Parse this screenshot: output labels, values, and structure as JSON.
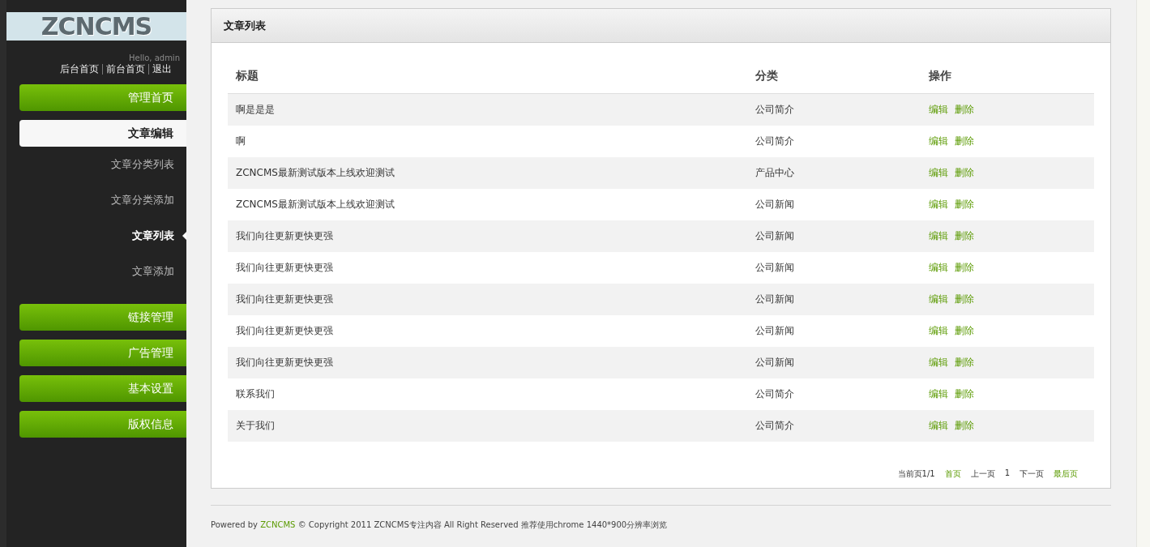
{
  "sidebar": {
    "logo": "ZCNCMS",
    "greeting": "Hello, admin",
    "links": [
      "后台首页",
      "前台首页",
      "退出"
    ],
    "menu": [
      {
        "kind": "button",
        "label": "管理首页"
      },
      {
        "kind": "group",
        "label": "文章编辑",
        "expanded": true,
        "children": [
          {
            "label": "文章分类列表",
            "selected": false
          },
          {
            "label": "文章分类添加",
            "selected": false
          },
          {
            "label": "文章列表",
            "selected": true
          },
          {
            "label": "文章添加",
            "selected": false
          }
        ]
      },
      {
        "kind": "button",
        "label": "链接管理"
      },
      {
        "kind": "button",
        "label": "广告管理"
      },
      {
        "kind": "button",
        "label": "基本设置"
      },
      {
        "kind": "button",
        "label": "版权信息"
      }
    ]
  },
  "panel": {
    "title": "文章列表",
    "table": {
      "columns": [
        "标题",
        "分类",
        "操作"
      ],
      "rows": [
        {
          "title": "啊是是是",
          "category": "公司简介",
          "actions": [
            "编辑",
            "删除"
          ]
        },
        {
          "title": "啊",
          "category": "公司简介",
          "actions": [
            "编辑",
            "删除"
          ]
        },
        {
          "title": "ZCNCMS最新测试版本上线欢迎测试",
          "category": "产品中心",
          "actions": [
            "编辑",
            "删除"
          ]
        },
        {
          "title": "ZCNCMS最新测试版本上线欢迎测试",
          "category": "公司新闻",
          "actions": [
            "编辑",
            "删除"
          ]
        },
        {
          "title": "我们向往更新更快更强",
          "category": "公司新闻",
          "actions": [
            "编辑",
            "删除"
          ]
        },
        {
          "title": "我们向往更新更快更强",
          "category": "公司新闻",
          "actions": [
            "编辑",
            "删除"
          ]
        },
        {
          "title": "我们向往更新更快更强",
          "category": "公司新闻",
          "actions": [
            "编辑",
            "删除"
          ]
        },
        {
          "title": "我们向往更新更快更强",
          "category": "公司新闻",
          "actions": [
            "编辑",
            "删除"
          ]
        },
        {
          "title": "我们向往更新更快更强",
          "category": "公司新闻",
          "actions": [
            "编辑",
            "删除"
          ]
        },
        {
          "title": "联系我们",
          "category": "公司简介",
          "actions": [
            "编辑",
            "删除"
          ]
        },
        {
          "title": "关于我们",
          "category": "公司简介",
          "actions": [
            "编辑",
            "删除"
          ]
        }
      ]
    },
    "pagination": [
      {
        "kind": "text",
        "label": "当前页1/1"
      },
      {
        "kind": "link",
        "label": "首页"
      },
      {
        "kind": "text",
        "label": "上一页"
      },
      {
        "kind": "text",
        "label": "1"
      },
      {
        "kind": "text",
        "label": "下一页"
      },
      {
        "kind": "link",
        "label": "最后页"
      }
    ]
  },
  "footer": {
    "before": "Powered by",
    "link": "ZCNCMS",
    "after": "© Copyright 2011 ZCNCMS专注内容  All Right Reserved 推荐使用chrome 1440*900分辨率浏览"
  }
}
